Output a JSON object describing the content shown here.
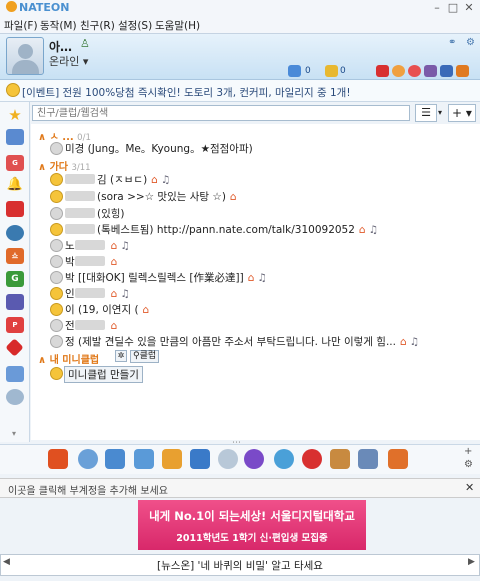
{
  "app": {
    "title": "NATEON"
  },
  "menu": [
    "파일(F)",
    "동작(M)",
    "친구(R)",
    "설정(S)",
    "도움말(H)"
  ],
  "profile": {
    "nick": "아…",
    "status": "온라인 ▾",
    "mail_count": "0",
    "memo_count": "0"
  },
  "notice": "[이벤트] 전원 100%당첨 즉시확인! 도토리 3개, 컨커피, 마일리지 중 1개!",
  "search": {
    "placeholder": "친구/클럽/웹검색"
  },
  "groups": [
    {
      "name": "ㅅ ...",
      "count": "0/1"
    },
    {
      "name": "가다",
      "count": "3/11"
    },
    {
      "name": "내 미니클럽",
      "count": ""
    }
  ],
  "buddies": [
    "미경 (Jung。Me。Kyoung。★점점아파)",
    "김 (ㅈㅂㄷ)",
    "(sora >>☆ 맛있는 사탕 ☆)",
    "(있힝)",
    "(톡베스트됨) http://pann.nate.com/talk/310092052",
    "노",
    "박",
    "박 [[대화OK] 릴렉스릴렉스 [作業必達]]",
    "인",
    "이 (19, 이연지 (",
    "전",
    "정 (제발 견딜수 있을 만큼의 아픔만 주소서 부탁드립니다. 나만 이렇게 힘..."
  ],
  "club": {
    "button": "클럽",
    "make": "미니클럽 만들기"
  },
  "statusbar": {
    "text": "이곳을 클릭해 부계정을 추가해 보세요"
  },
  "banner": {
    "line1": "내게 No.1이 되는세상! 서울디지털대학교",
    "line2": "2011학년도 1학기 신·편입생 모집중"
  },
  "news": {
    "text": "[뉴스온] '네 바퀴의 비밀' 알고 타세요"
  },
  "colors": {
    "accent": "#e07818",
    "header_bg": "#c8e1f4",
    "banner": "#e03a78"
  }
}
